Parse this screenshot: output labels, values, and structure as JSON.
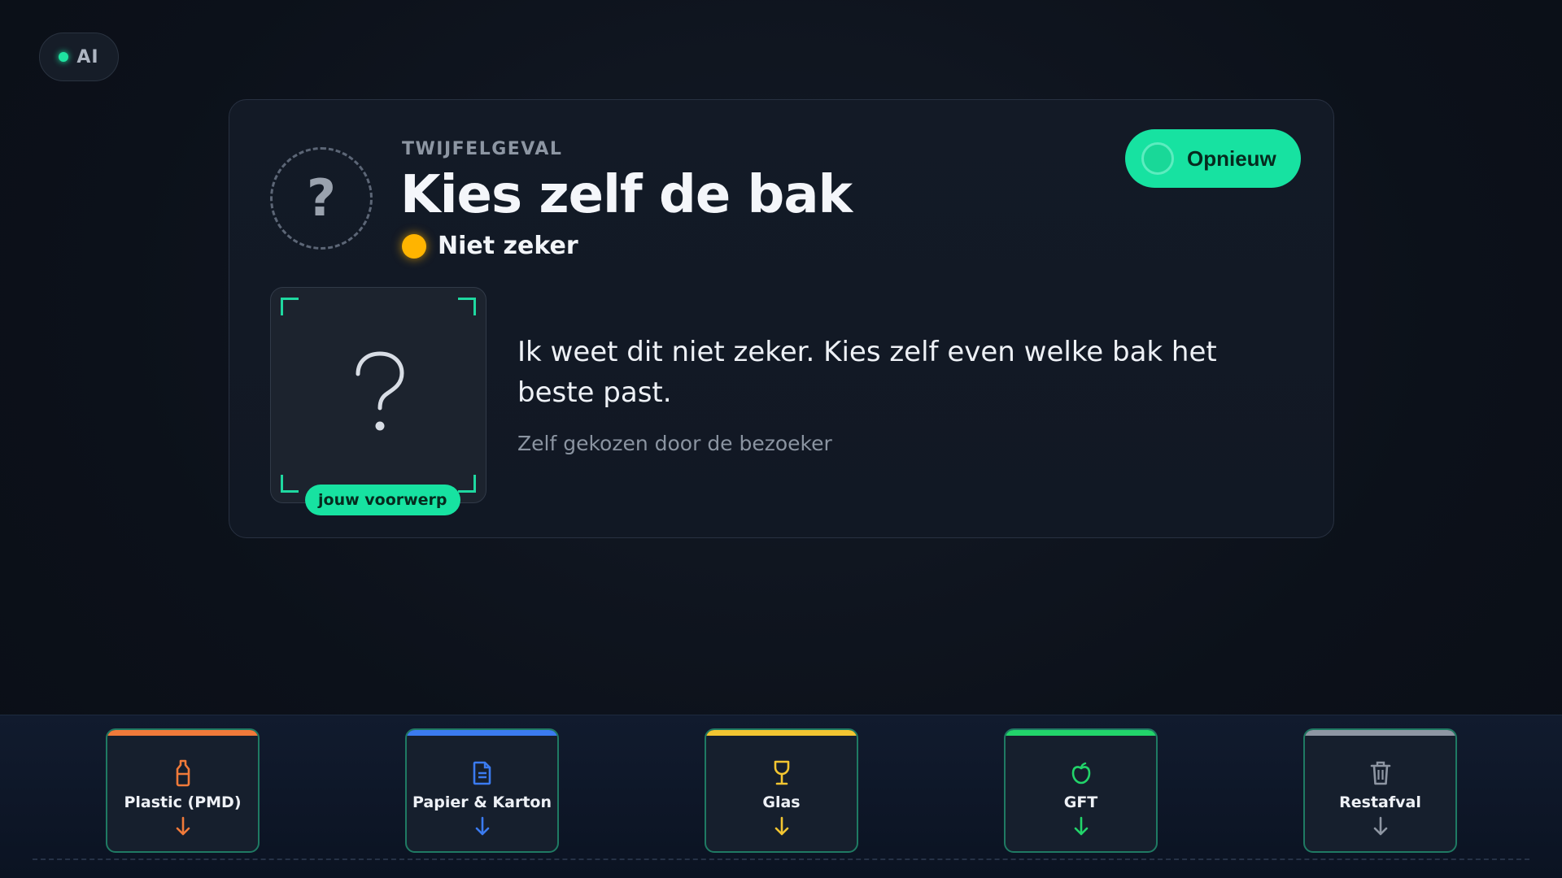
{
  "badge": {
    "label": "AI"
  },
  "card": {
    "eyebrow": "TWIJFELGEVAL",
    "title": "Kies zelf de bak",
    "status": "Niet zeker",
    "retry_label": "Opnieuw",
    "item_tag": "jouw voorwerp",
    "message": "Ik weet dit niet zeker. Kies zelf even welke bak het beste past.",
    "subtext": "Zelf gekozen door de bezoeker",
    "question_glyph": "?"
  },
  "bins": [
    {
      "label": "Plastic (PMD)",
      "color": "#f07a3a",
      "icon": "bottle-icon"
    },
    {
      "label": "Papier & Karton",
      "color": "#3b7bf0",
      "icon": "document-icon"
    },
    {
      "label": "Glas",
      "color": "#f2c531",
      "icon": "wine-glass-icon"
    },
    {
      "label": "GFT",
      "color": "#22d46a",
      "icon": "apple-icon"
    },
    {
      "label": "Restafval",
      "color": "#8e96a3",
      "icon": "trash-icon"
    }
  ],
  "colors": {
    "accent": "#17e2a1",
    "warning": "#ffb400",
    "background": "#0c111a"
  }
}
